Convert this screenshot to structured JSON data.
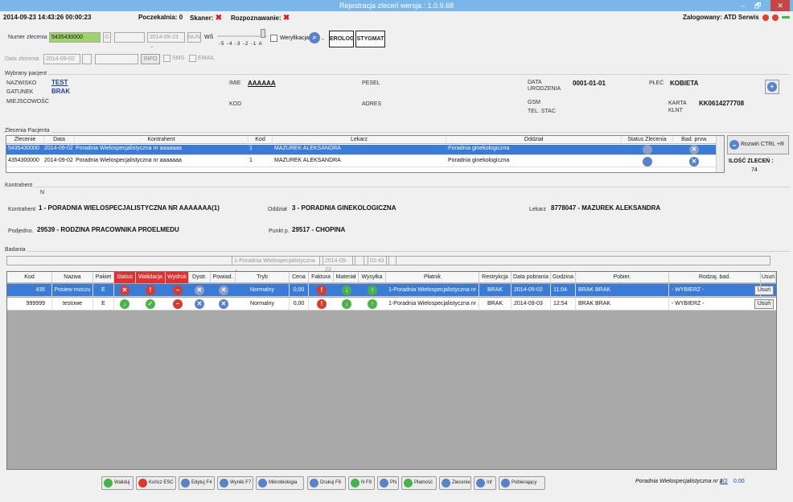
{
  "window": {
    "title": "Rejestracja zleceń wersja : 1.0.9.68",
    "minimize": "–",
    "restore": "🗗",
    "close": "✕"
  },
  "status": {
    "datetime": "2014-09-23 14:43:26 00:00:23",
    "poczekalnia": "Poczekalnia: 0",
    "skaner": "Skaner:",
    "rozpoznawanie": "Rozpoznawanie:",
    "zalogowany": "Zalogowany: ATD Serwis"
  },
  "order": {
    "numer_label": "Numer zlecenia",
    "numer_value": "5435430000",
    "g_label": "G",
    "date_value": "2014-09-23",
    "nun_label": "NUN",
    "ws_label": "WŚ",
    "scale_ticks": "-5 -4 -3 -2 -1 A",
    "weryfikacja": "Weryfikacja",
    "dash": "-",
    "serolog": "EROLOG",
    "stygmat": "STYGMAT",
    "data_zlecenia_label": "Data zlecenia",
    "data_zlecenia_value": "2014-09-02",
    "info": "INFO",
    "sms": "SMS",
    "email": "EMAIL"
  },
  "patient": {
    "section": "Wybrany pacjent",
    "nazwisko_label": "NAZWISKO",
    "nazwisko": "TEST",
    "gatunek_label": "GATUNEK",
    "gatunek": "BRAK",
    "miejscowosc_label": "MIEJSCOWOŚĆ",
    "imie_label": "IMIE",
    "imie": "AAAAAA",
    "kod_label": "KOD",
    "pesel_label": "PESEL",
    "adres_label": "ADRES",
    "data_urodzenia_label": "DATA URODZENIA",
    "data_urodzenia": "0001-01-01",
    "gsm_label": "GSM",
    "tel_stac_label": "TEL. STAC",
    "plec_label": "PŁEĆ",
    "plec": "KOBIETA",
    "karta_label": "KARTA KLNT",
    "karta": "KK0614277708"
  },
  "orders": {
    "section": "Zlecenia Pacjenta",
    "columns": [
      "Zlecenie",
      "Data",
      "Kontrahent",
      "Kod",
      "Lekarz",
      "Oddział",
      "Status Zlecenia",
      "Bad. prvw."
    ],
    "rows": [
      [
        "5435430000",
        "2014-09-02",
        "Poradnia Wielospecjalistyczna nr aaaaaaa",
        "1",
        "MAZUREK ALEKSANDRA",
        "Poradnia ginekologiczna"
      ],
      [
        "4354300000",
        "2014-09-02",
        "Poradnia Wielospecjalistyczna nr aaaaaaa",
        "1",
        "MAZUREK ALEKSANDRA",
        "Poradnia ginekologiczna"
      ]
    ],
    "rozwin": "Rozwiń CTRL +R",
    "ilosc_label": "ILOŚĆ ZLECEŃ :",
    "ilosc": "74"
  },
  "kontrahent": {
    "section": "Kontrahent",
    "n": "N",
    "kontrahent_label": "Kontrahent",
    "kontrahent": "1 - PORADNIA WIELOSPECJALISTYCZNA NR AAAAAAA(1)",
    "oddzial_label": "Oddział",
    "oddzial": "3 - PORADNIA GINEKOLOGICZNA",
    "lekarz_label": "Lekarz",
    "lekarz": "8778047 - MAZUREK ALEKSANDRA",
    "podjedno_label": "Podjedno.",
    "podjedno": "29539 - RODZINA PRACOWNIKA PROELMEDU",
    "punkt_label": "Punkt p.",
    "punkt": "29517 - CHOPINA"
  },
  "badania": {
    "section": "Badania",
    "filter_select": "1-Poradnia Wielospecjalistyczna",
    "filter_date": "2014-09-23",
    "filter_time": "02:43",
    "columns": [
      "Kod",
      "Nazwa",
      "Pakiet",
      "Status",
      "Walidacja",
      "Wydruk",
      "Dystr.",
      "Powiad.",
      "Tryb",
      "Cena",
      "Faktura",
      "Materiał",
      "Wysyłka",
      "Płatnik",
      "Restrykcja",
      "Data pobrania",
      "Godzina",
      "Pobier.",
      "Rodzaj. bad.",
      "Usuń"
    ],
    "rows": [
      {
        "kod": "435",
        "nazwa": "Posiew moczu",
        "pakiet": "E",
        "tryb": "Normalny",
        "cena": "0,00",
        "platnik": "1-Poradnia Wielospecjalistyczna nr ...",
        "restrykcja": "BRAK",
        "data": "2014-09-02",
        "godzina": "11:04",
        "pobier": "BRAK BRAK",
        "rodzaj": "- WYBIERZ -",
        "usun": "Usuń"
      },
      {
        "kod": "999999",
        "nazwa": "testowe",
        "pakiet": "E",
        "tryb": "Normalny",
        "cena": "0,00",
        "platnik": "1-Poradnia Wielospecjalistyczna nr ...",
        "restrykcja": "BRAK",
        "data": "2014-09-03",
        "godzina": "12:54",
        "pobier": "BRAK BRAK",
        "rodzaj": "- WYBIERZ -",
        "usun": "Usuń"
      }
    ]
  },
  "toolbar": {
    "waliduj": "Waliduj",
    "koncz": "Kończ ESC",
    "edytuj": "Edytuj F4",
    "wyniki": "Wyniki F7",
    "mikrobiologia": "Mikrobiologia",
    "drukuj": "Drukuj F8",
    "nf9": "N F9",
    "pn": "PN",
    "platnosc": "Płatność",
    "zlecenie": "Zlecenie",
    "inf": "Inf",
    "pobierajacy": "Pobierający"
  },
  "footer": {
    "poradnia": "Poradnia Wielospecjalistyczna nr a",
    "page": "2/2",
    "amount": "0.00"
  },
  "colors": {
    "titlebar": "#7ab7e8",
    "selection": "#3a7bd5",
    "status_red": "#e03030"
  }
}
